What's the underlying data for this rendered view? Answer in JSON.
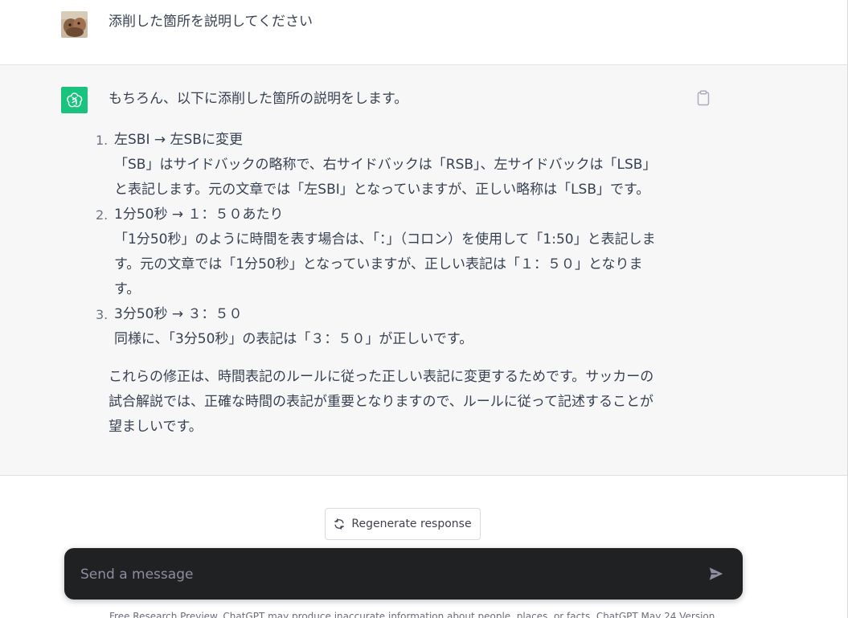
{
  "user_message": {
    "text": "添削した箇所を説明してください"
  },
  "assistant_message": {
    "intro": "もちろん、以下に添削した箇所の説明をします。",
    "items": [
      {
        "number": "1.",
        "title": "左SBI → 左SBに変更",
        "lines": [
          "「SB」はサイドバックの略称で、右サイドバックは「RSB」、左サイドバックは「LSB」",
          "と表記します。元の文章では「左SBI」となっていますが、正しい略称は「LSB」です。"
        ]
      },
      {
        "number": "2.",
        "title": "1分50秒 → １：５０あたり",
        "lines": [
          "「1分50秒」のように時間を表す場合は、「：」（コロン）を使用して「1:50」と表記しま",
          "す。元の文章では「1分50秒」となっていますが、正しい表記は「１：５０」となりま",
          "す。"
        ]
      },
      {
        "number": "3.",
        "title": "3分50秒 → ３：５０",
        "lines": [
          "同様に、「3分50秒」の表記は「３：５０」が正しいです。"
        ]
      }
    ],
    "closing_lines": [
      "これらの修正は、時間表記のルールに従った正しい表記に変更するためです。サッカーの",
      "試合解説では、正確な時間の表記が重要となりますので、ルールに従って記述することが",
      "望ましいです。"
    ]
  },
  "regenerate": {
    "label": "Regenerate response"
  },
  "composer": {
    "placeholder": "Send a message"
  },
  "footer": {
    "text": "Free Research Preview. ChatGPT may produce inaccurate information about people, places, or facts. ChatGPT May 24 Version"
  },
  "colors": {
    "assistant_avatar": "#19c37d",
    "assistant_bg": "#f7f7f8",
    "composer_bg": "#202123"
  },
  "icons": {
    "user_avatar": "user-avatar-photo",
    "assistant_avatar": "openai-logo-icon",
    "copy": "clipboard-icon",
    "regenerate": "refresh-icon",
    "send": "send-arrow-icon"
  }
}
